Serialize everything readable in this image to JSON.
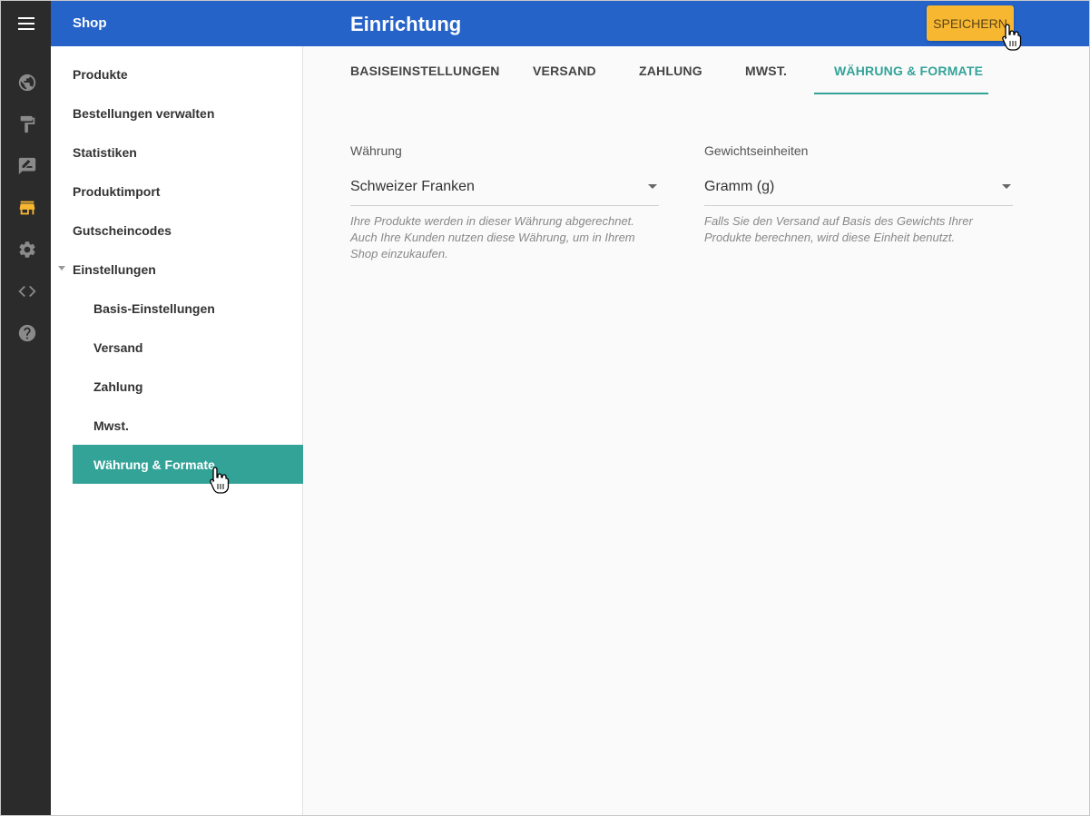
{
  "topbar": {
    "section_title": "Shop",
    "page_title": "Einrichtung",
    "save_label": "SPEICHERN"
  },
  "rail": {
    "icons": [
      "globe-icon",
      "paint-roller-icon",
      "signature-icon",
      "store-icon",
      "gear-icon",
      "code-icon",
      "help-icon"
    ],
    "active_color": "#f7b731",
    "icon_color": "#8a8a8a"
  },
  "sidebar": {
    "items": [
      {
        "label": "Produkte"
      },
      {
        "label": "Bestellungen verwalten"
      },
      {
        "label": "Statistiken"
      },
      {
        "label": "Produktimport"
      },
      {
        "label": "Gutscheincodes"
      },
      {
        "label": "Einstellungen"
      }
    ],
    "subitems": [
      {
        "label": "Basis-Einstellungen"
      },
      {
        "label": "Versand"
      },
      {
        "label": "Zahlung"
      },
      {
        "label": "Mwst."
      },
      {
        "label": "Währung & Formate"
      }
    ]
  },
  "tabs": [
    {
      "label": "BASISEINSTELLUNGEN"
    },
    {
      "label": "VERSAND"
    },
    {
      "label": "ZAHLUNG"
    },
    {
      "label": "MWST."
    },
    {
      "label": "WÄHRUNG & FORMATE"
    }
  ],
  "form": {
    "currency": {
      "label": "Währung",
      "value": "Schweizer Franken",
      "hint_line1": "Ihre Produkte werden in dieser Währung abgerechnet.",
      "hint_line2": "Auch Ihre Kunden nutzen diese Währung, um in Ihrem",
      "hint_line3": "Shop einzukaufen."
    },
    "weight": {
      "label": "Gewichtseinheiten",
      "value": "Gramm (g)",
      "hint_line1": "Falls Sie den Versand auf Basis des Gewichts Ihrer",
      "hint_line2": "Produkte berechnen, wird diese Einheit benutzt."
    }
  },
  "colors": {
    "topbar": "#2563c9",
    "accent": "#33a398",
    "save": "#f7b731"
  }
}
